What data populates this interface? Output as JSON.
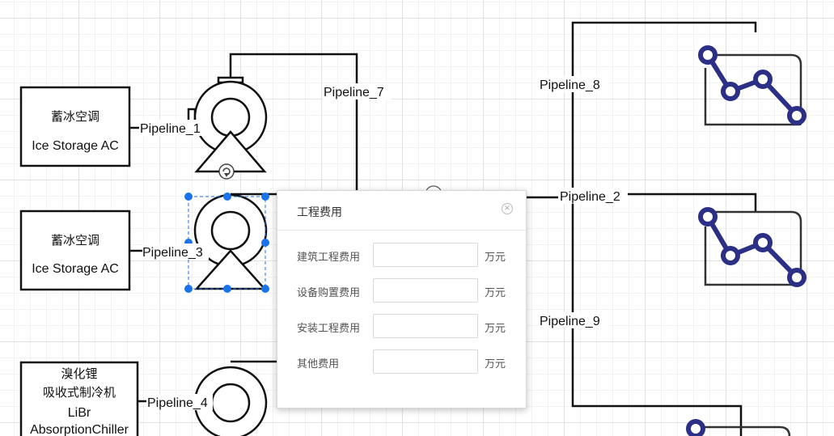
{
  "blocks": {
    "b1": {
      "cn": "蓄冰空调",
      "en": "Ice Storage AC"
    },
    "b2": {
      "cn": "蓄冰空调",
      "en": "Ice Storage AC"
    },
    "b3": {
      "cn1": "溴化锂",
      "cn2": "吸收式制冷机",
      "en1": "LiBr",
      "en2": "AbsorptionChiller"
    }
  },
  "pipelines": {
    "p1": "Pipeline_1",
    "p3": "Pipeline_3",
    "p4": "Pipeline_4",
    "p7": "Pipeline_7",
    "p8": "Pipeline_8",
    "p2": "Pipeline_2",
    "p9": "Pipeline_9"
  },
  "dialog": {
    "title": "工程费用",
    "close_glyph": "×",
    "fields": [
      {
        "label": "建筑工程费用",
        "value": "",
        "unit": "万元"
      },
      {
        "label": "设备购置费用",
        "value": "",
        "unit": "万元"
      },
      {
        "label": "安装工程费用",
        "value": "",
        "unit": "万元"
      },
      {
        "label": "其他费用",
        "value": "",
        "unit": "万元"
      }
    ]
  },
  "colors": {
    "line": "#111111",
    "chain_icon": "#2b2f86",
    "chain_frame": "#333333",
    "selection": "#1a73e8"
  },
  "icons": [
    "pump-icon",
    "chain-link-icon",
    "rotate-handle-icon"
  ]
}
